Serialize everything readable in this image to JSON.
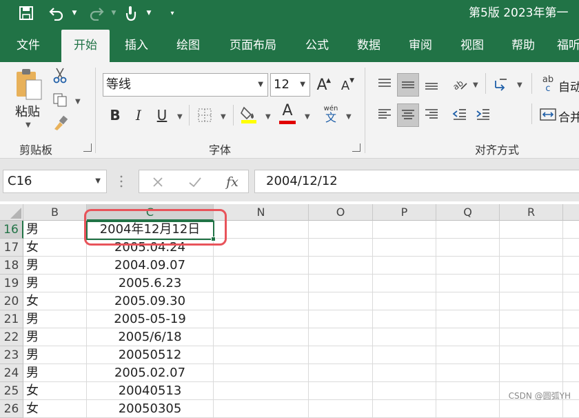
{
  "titlebar": {
    "title": "第5版 2023年第一",
    "bg_color": "#217346",
    "icons": [
      "save-icon",
      "undo-icon",
      "redo-icon",
      "touch-mode-icon",
      "customize-toolbar-icon"
    ]
  },
  "tabs": [
    {
      "label": "文件",
      "active": false
    },
    {
      "label": "开始",
      "active": true
    },
    {
      "label": "插入",
      "active": false
    },
    {
      "label": "绘图",
      "active": false
    },
    {
      "label": "页面布局",
      "active": false
    },
    {
      "label": "公式",
      "active": false
    },
    {
      "label": "数据",
      "active": false
    },
    {
      "label": "审阅",
      "active": false
    },
    {
      "label": "视图",
      "active": false
    },
    {
      "label": "帮助",
      "active": false
    },
    {
      "label": "福听",
      "active": false
    }
  ],
  "ribbon": {
    "clipboard": {
      "group_label": "剪贴板",
      "paste_label": "粘贴"
    },
    "font": {
      "group_label": "字体",
      "font_name": "等线",
      "font_size": "12",
      "grow_font": "A",
      "shrink_font": "A",
      "bold": "B",
      "italic": "I",
      "underline": "U",
      "font_color_letter": "A",
      "phonetic_top": "wén",
      "phonetic_bottom": "文",
      "highlight_color": "#ffff00",
      "font_color": "#e00000"
    },
    "alignment": {
      "group_label": "对齐方式",
      "wrap_label": "自动",
      "merge_label": "合并",
      "wrap_icon_text": "ab",
      "wrap_icon_text2": "c"
    }
  },
  "formula_bar": {
    "name_box": "C16",
    "fx_label": "fx",
    "content": "2004/12/12"
  },
  "sheet": {
    "columns": [
      "B",
      "C",
      "N",
      "O",
      "P",
      "Q",
      "R"
    ],
    "selected_column": "C",
    "selected_row": "16",
    "rows": [
      {
        "row": "16",
        "b": "男",
        "c": "2004年12月12日"
      },
      {
        "row": "17",
        "b": "女",
        "c": "2005.04.24"
      },
      {
        "row": "18",
        "b": "男",
        "c": "2004.09.07"
      },
      {
        "row": "19",
        "b": "男",
        "c": "2005.6.23"
      },
      {
        "row": "20",
        "b": "女",
        "c": "2005.09.30"
      },
      {
        "row": "21",
        "b": "男",
        "c": "2005-05-19"
      },
      {
        "row": "22",
        "b": "男",
        "c": "2005/6/18"
      },
      {
        "row": "23",
        "b": "男",
        "c": "20050512"
      },
      {
        "row": "24",
        "b": "男",
        "c": "2005.02.07"
      },
      {
        "row": "25",
        "b": "女",
        "c": "20040513"
      },
      {
        "row": "26",
        "b": "女",
        "c": "20050305"
      }
    ]
  },
  "watermark": "CSDN @圆弧YH",
  "accent_color": "#217346",
  "highlight_border_color": "#e8535a"
}
